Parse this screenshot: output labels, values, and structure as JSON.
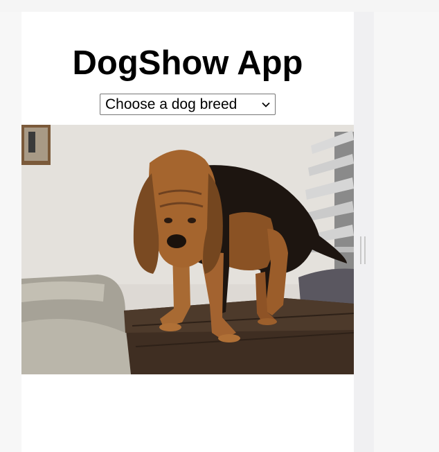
{
  "app": {
    "title": "DogShow App"
  },
  "breed_select": {
    "selected_label": "Choose a dog breed"
  },
  "dog_image": {
    "subject": "bloodhound standing on a wooden table"
  },
  "colors": {
    "panel_background": "#ffffff",
    "page_background": "#f7f7f7",
    "gutter": "#f0f0f2"
  }
}
